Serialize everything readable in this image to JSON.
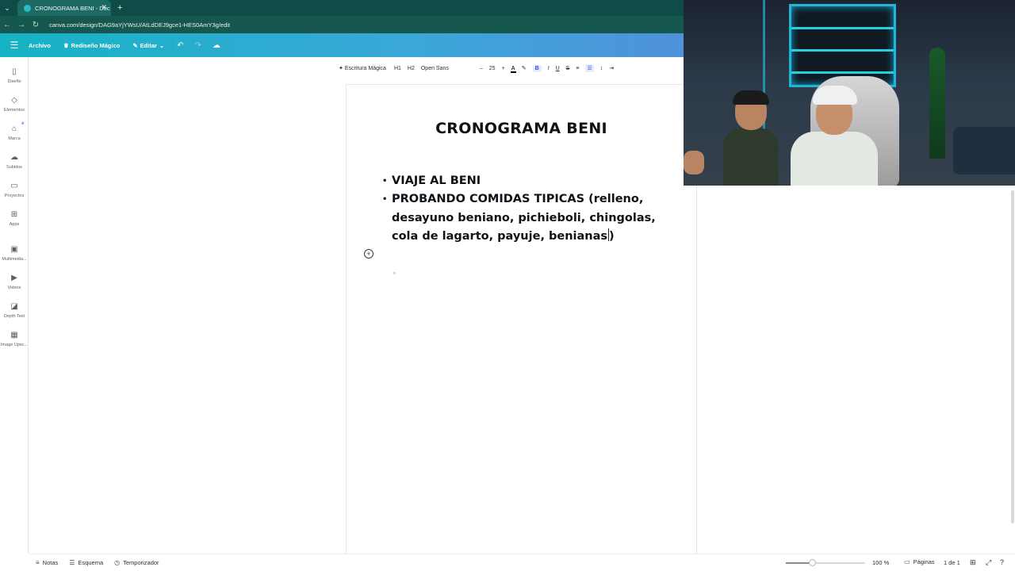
{
  "browser": {
    "tab_title": "CRONOGRAMA BENI - Doc",
    "url": "canva.com/design/DAG9aYjYWsU/AtLdDEJ9gce1-HES0AmY3g/edit",
    "icons": {
      "menu": "chevron-down-icon",
      "close": "close-icon",
      "new_tab": "plus-icon"
    }
  },
  "header": {
    "file_menu": "Archivo",
    "magic_resize": "Rediseño Mágico",
    "edit": "Editar"
  },
  "sidebar": {
    "items": [
      {
        "label": "Diseño",
        "icon": "template-icon"
      },
      {
        "label": "Elementos",
        "icon": "shapes-icon"
      },
      {
        "label": "Marca",
        "icon": "brand-icon"
      },
      {
        "label": "Subidos",
        "icon": "cloud-upload-icon"
      },
      {
        "label": "Proyectos",
        "icon": "folder-icon"
      },
      {
        "label": "Apps",
        "icon": "apps-grid-icon"
      },
      {
        "label": "Multimedia...",
        "icon": "multimedia-icon"
      },
      {
        "label": "Videos",
        "icon": "video-icon"
      },
      {
        "label": "Depth Text",
        "icon": "depth-text-app-icon"
      },
      {
        "label": "Image Upsc...",
        "icon": "image-upscale-app-icon"
      }
    ]
  },
  "text_toolbar": {
    "magic_write": "Escritura Mágica",
    "h1": "H1",
    "h2": "H2",
    "font": "Open Sans",
    "size": "25",
    "minus": "–",
    "plus": "+",
    "bold": "B",
    "italic": "I",
    "underline": "U",
    "strike": "S"
  },
  "document": {
    "title": "CRONOGRAMA BENI",
    "bullets": [
      "VIAJE AL BENI",
      "PROBANDO COMIDAS TIPICAS (relleno, desayuno beniano, pichieboli, chingolas, cola de lagarto, payuje, benianas)"
    ],
    "bullet2_before_caret": "PROBANDO COMIDAS TIPICAS (relleno, desayuno beniano, pichieboli, chingolas, cola de lagarto, payuje, benianas",
    "bullet2_after_caret": ")"
  },
  "bottom_bar": {
    "notes": "Notas",
    "outline": "Esquema",
    "timer": "Temporizador",
    "zoom": "100 %",
    "zoom_fraction": 0.33,
    "pages": "Páginas",
    "page_count": "1 de 1"
  },
  "colors": {
    "header_gradient_start": "#16b3c4",
    "header_gradient_end": "#6a78e0",
    "tab_bar": "#0f4c47",
    "accent": "#1e4fff"
  }
}
